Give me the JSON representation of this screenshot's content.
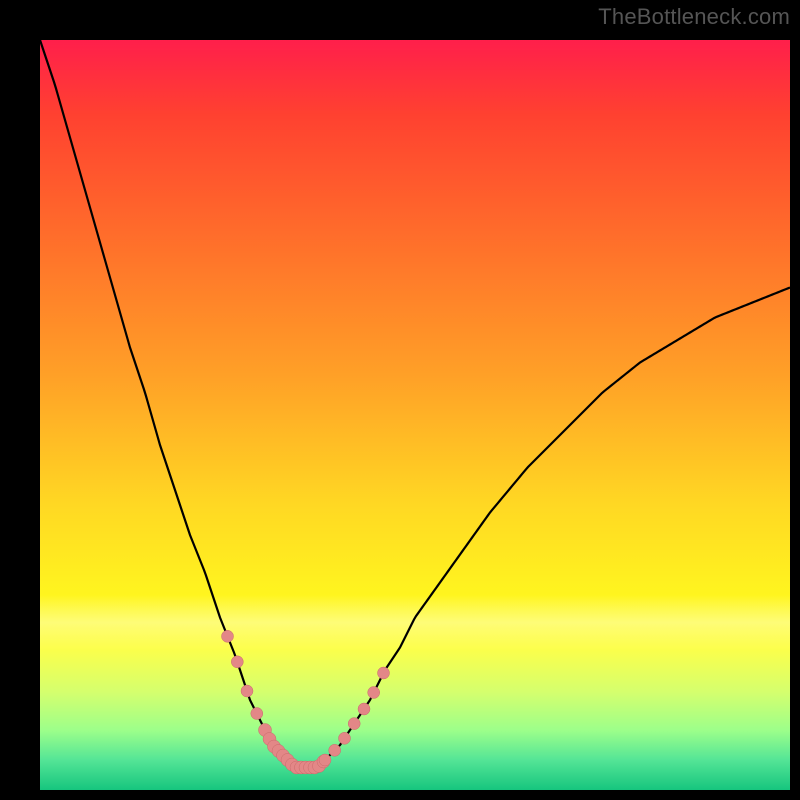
{
  "watermark": "TheBottleneck.com",
  "colors": {
    "background": "#000000",
    "gradient_top": "#ff1f4b",
    "gradient_bottom": "#16c57e",
    "curve": "#000000",
    "marker_fill": "#e38787",
    "marker_stroke": "#c96b6b"
  },
  "chart_data": {
    "type": "line",
    "title": "",
    "xlabel": "",
    "ylabel": "",
    "xlim": [
      0,
      100
    ],
    "ylim": [
      0,
      100
    ],
    "grid": false,
    "legend": false,
    "x": [
      0,
      2,
      4,
      6,
      8,
      10,
      12,
      14,
      16,
      18,
      20,
      22,
      24,
      26,
      27,
      28,
      29,
      30,
      31,
      32,
      33,
      34,
      35,
      36,
      37,
      38,
      40,
      42,
      44,
      46,
      48,
      50,
      55,
      60,
      65,
      70,
      75,
      80,
      85,
      90,
      95,
      100
    ],
    "y": [
      100,
      94,
      87,
      80,
      73,
      66,
      59,
      53,
      46,
      40,
      34,
      29,
      23,
      18,
      15,
      12,
      10,
      8,
      6,
      5,
      4,
      3,
      3,
      3,
      3,
      4,
      6,
      9,
      12,
      16,
      19,
      23,
      30,
      37,
      43,
      48,
      53,
      57,
      60,
      63,
      65,
      67
    ],
    "marker_segments": [
      {
        "x_start": 25,
        "x_end": 30,
        "density": "medium"
      },
      {
        "x_start": 30,
        "x_end": 38,
        "density": "dense"
      },
      {
        "x_start": 38,
        "x_end": 46,
        "density": "medium"
      }
    ],
    "notes": "V-shaped bottleneck curve; minimum (~3%) around x≈35. Left branch falls steeply from 100% at x=0; right branch rises more gently toward ~67% at x=100. Pink dot markers cluster in and around the valley (roughly x 25–46). Background is a vertical heat gradient: red (high bottleneck) at top → yellow mid → green (optimal) near bottom, inside a black frame."
  }
}
